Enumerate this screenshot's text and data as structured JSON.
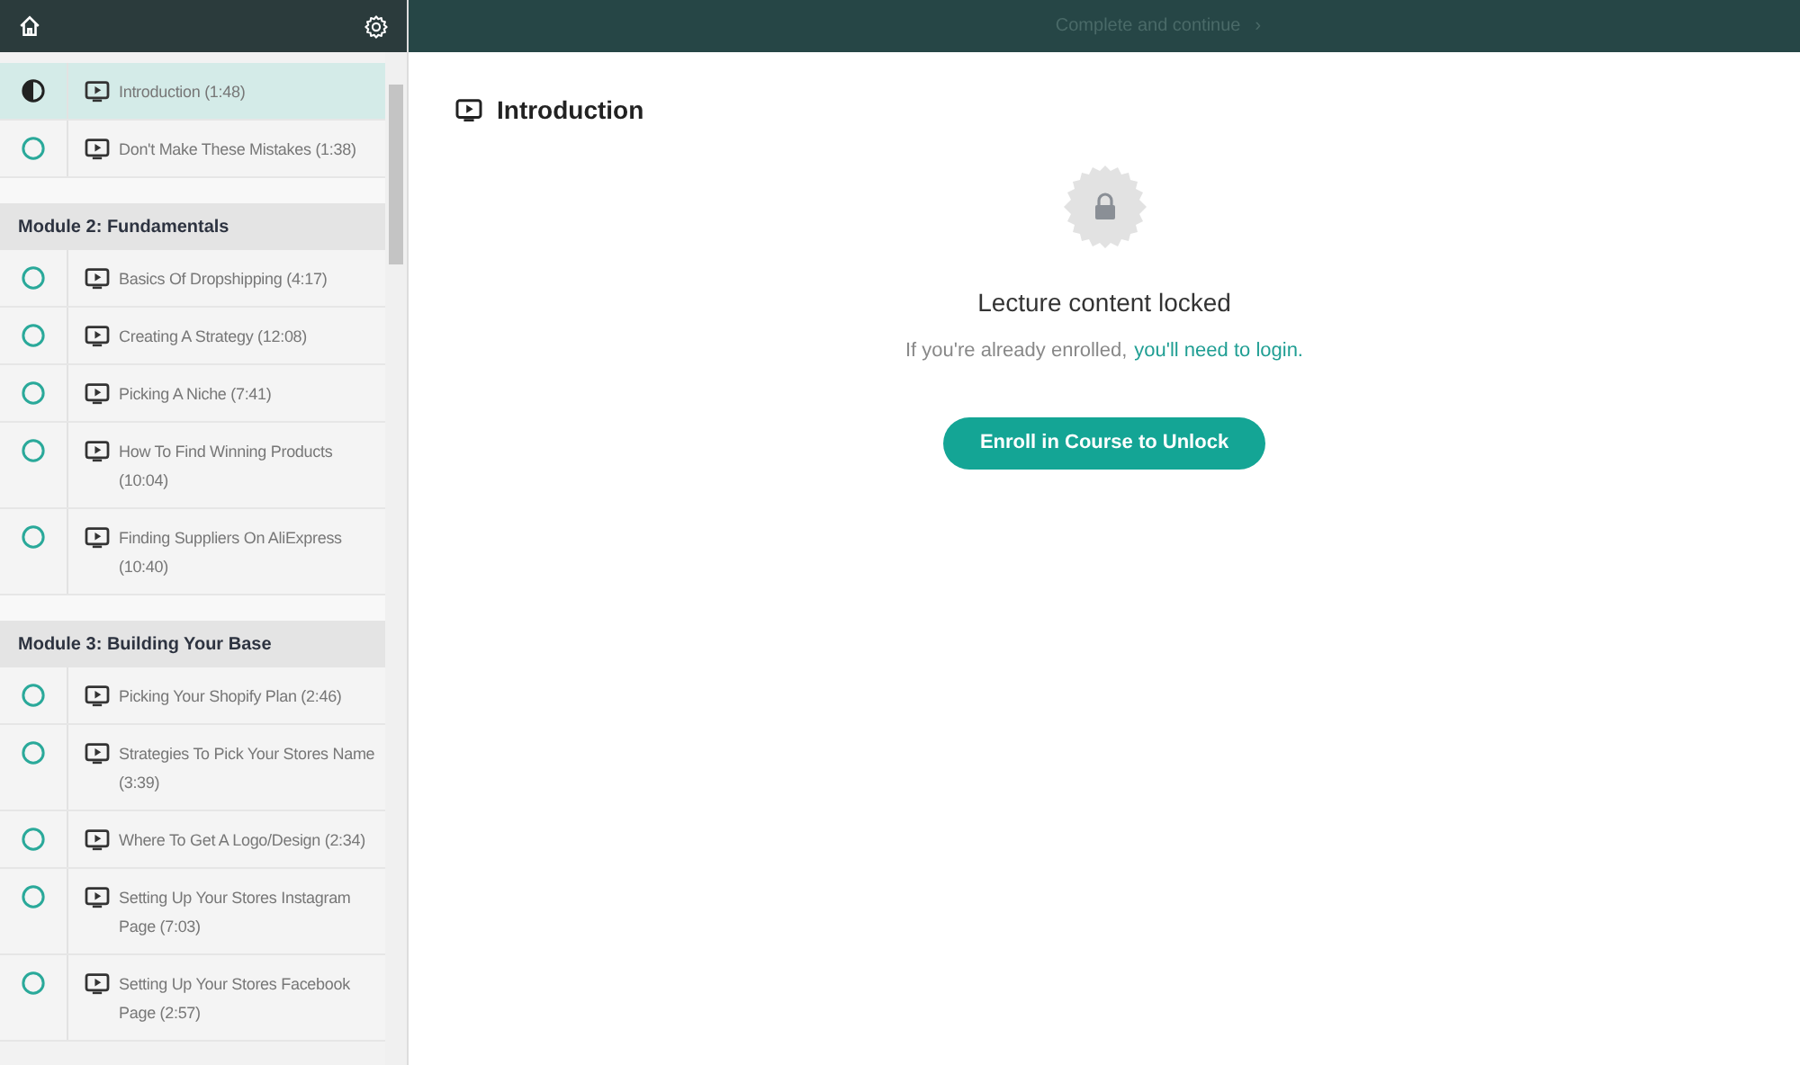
{
  "top_bar": {
    "continue_label": "Complete and continue",
    "continue_arrow": "›",
    "disabled": true
  },
  "sections": [
    {
      "lessons": [
        {
          "title": "Introduction (1:48)",
          "selected": true,
          "in_progress": true
        },
        {
          "title": "Don't Make These Mistakes (1:38)",
          "selected": false,
          "in_progress": false
        }
      ]
    },
    {
      "title": "Module 2: Fundamentals",
      "lessons": [
        {
          "title": "Basics Of Dropshipping (4:17)",
          "selected": false,
          "in_progress": false
        },
        {
          "title": "Creating A Strategy (12:08)",
          "selected": false,
          "in_progress": false
        },
        {
          "title": "Picking A Niche (7:41)",
          "selected": false,
          "in_progress": false
        },
        {
          "title": "How To Find Winning Products (10:04)",
          "selected": false,
          "in_progress": false
        },
        {
          "title": "Finding Suppliers On AliExpress (10:40)",
          "selected": false,
          "in_progress": false
        }
      ]
    },
    {
      "title": "Module 3: Building Your Base",
      "lessons": [
        {
          "title": "Picking Your Shopify Plan (2:46)",
          "selected": false,
          "in_progress": false
        },
        {
          "title": "Strategies To Pick Your Stores Name (3:39)",
          "selected": false,
          "in_progress": false
        },
        {
          "title": "Where To Get A Logo/Design (2:34)",
          "selected": false,
          "in_progress": false
        },
        {
          "title": "Setting Up Your Stores Instagram Page (7:03)",
          "selected": false,
          "in_progress": false
        },
        {
          "title": "Setting Up Your Stores Facebook Page (2:57)",
          "selected": false,
          "in_progress": false
        }
      ]
    }
  ],
  "lecture": {
    "title": "Introduction",
    "locked_title": "Lecture content locked",
    "notice": "If you're already enrolled,",
    "login_link": "you'll need to login.",
    "enroll_button": "Enroll in Course to Unlock"
  }
}
